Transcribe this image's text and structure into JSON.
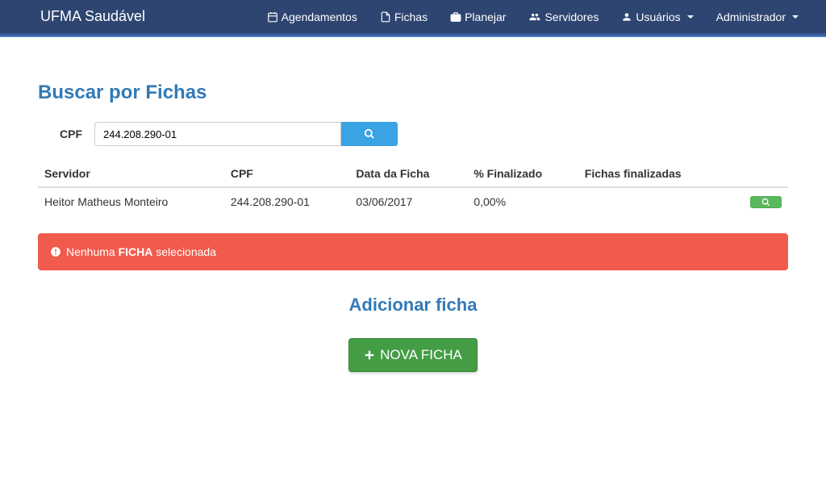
{
  "navbar": {
    "brand": "UFMA Saudável",
    "items": [
      {
        "label": "Agendamentos"
      },
      {
        "label": "Fichas"
      },
      {
        "label": "Planejar"
      },
      {
        "label": "Servidores"
      },
      {
        "label": "Usuários"
      },
      {
        "label": "Administrador"
      }
    ]
  },
  "page": {
    "title": "Buscar por Fichas"
  },
  "search": {
    "label": "CPF",
    "value": "244.208.290-01"
  },
  "table": {
    "headers": {
      "servidor": "Servidor",
      "cpf": "CPF",
      "data": "Data da Ficha",
      "pct": "% Finalizado",
      "finalizadas": "Fichas finalizadas"
    },
    "rows": [
      {
        "servidor": "Heitor Matheus Monteiro",
        "cpf": "244.208.290-01",
        "data": "03/06/2017",
        "pct": "0,00%",
        "finalizadas": ""
      }
    ]
  },
  "alert": {
    "prefix": "Nenhuma ",
    "bold": "FICHA",
    "suffix": " selecionada"
  },
  "add": {
    "title": "Adicionar ficha",
    "button": "NOVA FICHA"
  }
}
